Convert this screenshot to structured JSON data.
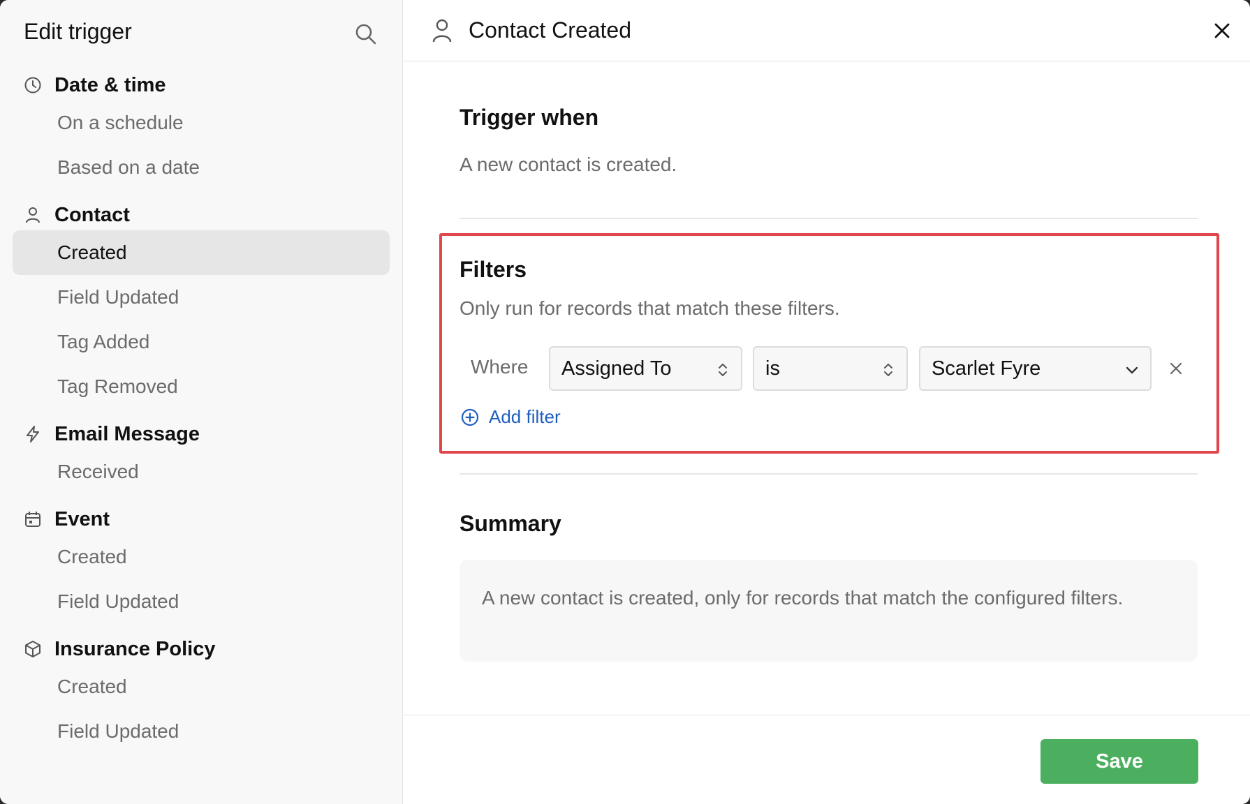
{
  "sidebar": {
    "title": "Edit trigger",
    "groups": [
      {
        "label": "Date & time",
        "icon": "clock-icon",
        "items": [
          "On a schedule",
          "Based on a date"
        ]
      },
      {
        "label": "Contact",
        "icon": "person-icon",
        "items": [
          "Created",
          "Field Updated",
          "Tag Added",
          "Tag Removed"
        ]
      },
      {
        "label": "Email Message",
        "icon": "lightning-icon",
        "items": [
          "Received"
        ]
      },
      {
        "label": "Event",
        "icon": "calendar-icon",
        "items": [
          "Created",
          "Field Updated"
        ]
      },
      {
        "label": "Insurance Policy",
        "icon": "cube-icon",
        "items": [
          "Created",
          "Field Updated"
        ]
      }
    ],
    "active_item": "Contact > Created"
  },
  "header": {
    "title": "Contact Created",
    "icon": "person-icon"
  },
  "trigger": {
    "title": "Trigger when",
    "description": "A new contact is created."
  },
  "filters": {
    "title": "Filters",
    "description": "Only run for records that match these filters.",
    "where_label": "Where",
    "field": "Assigned To",
    "operator": "is",
    "value": "Scarlet Fyre",
    "add_label": "Add filter"
  },
  "summary": {
    "title": "Summary",
    "text": "A new contact is created, only for records that match the configured filters."
  },
  "footer": {
    "save_label": "Save"
  },
  "colors": {
    "accent_green": "#4caf5f",
    "highlight_red": "#e0474c",
    "link_blue": "#1f5fbf"
  }
}
